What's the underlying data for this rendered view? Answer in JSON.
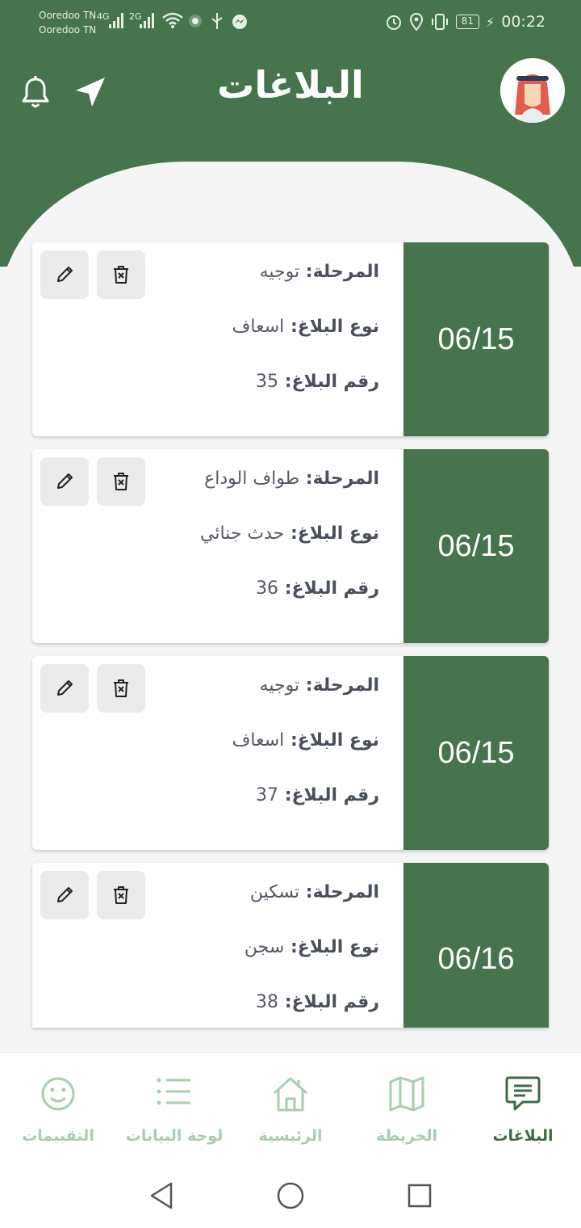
{
  "status_bar": {
    "carrier_1": "Ooredoo TN",
    "carrier_2": "Ooredoo TN",
    "net_1": "4G",
    "net_2": "2G",
    "battery": "81",
    "time": "00:22"
  },
  "header": {
    "title": "البلاغات"
  },
  "colors": {
    "primary": "#45744d",
    "nav_inactive": "#a9cdb0",
    "nav_active": "#3d6b45"
  },
  "labels": {
    "stage": "المرحلة:",
    "type": "نوع البلاغ:",
    "number": "رقم البلاغ:"
  },
  "reports": [
    {
      "date": "06/15",
      "stage": "توجيه",
      "type": "اسعاف",
      "number": "35"
    },
    {
      "date": "06/15",
      "stage": "طواف الوداع",
      "type": "حدث جنائي",
      "number": "36"
    },
    {
      "date": "06/15",
      "stage": "توجيه",
      "type": "اسعاف",
      "number": "37"
    },
    {
      "date": "06/16",
      "stage": "تسكين",
      "type": "سجن",
      "number": "38"
    }
  ],
  "bottom_nav": [
    {
      "label": "البلاغات",
      "icon": "chat-icon",
      "active": true
    },
    {
      "label": "الخريطة",
      "icon": "map-icon",
      "active": false
    },
    {
      "label": "الرئيسية",
      "icon": "home-icon",
      "active": false
    },
    {
      "label": "لوحة البيانات",
      "icon": "list-icon",
      "active": false
    },
    {
      "label": "التقييمات",
      "icon": "smiley-icon",
      "active": false
    }
  ]
}
